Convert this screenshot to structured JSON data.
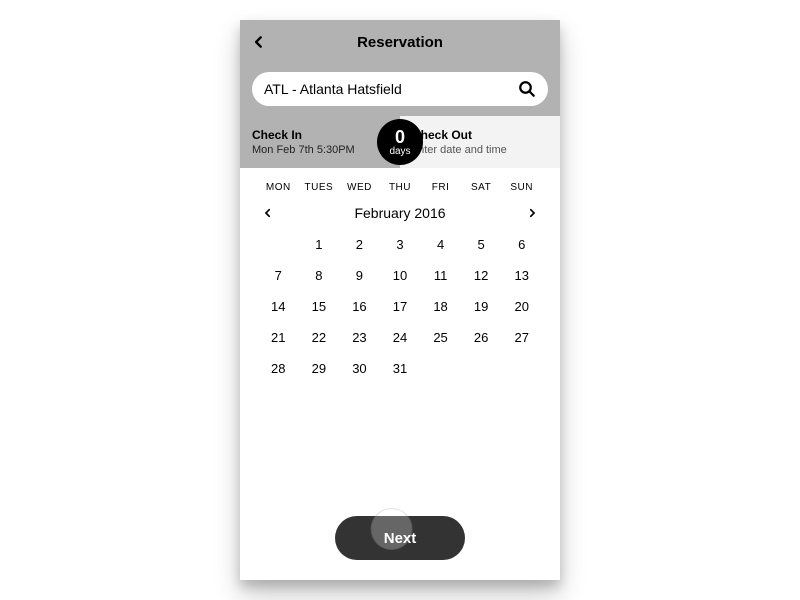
{
  "header": {
    "title": "Reservation"
  },
  "search": {
    "value": "ATL - Atlanta Hatsfield"
  },
  "check_in": {
    "label": "Check In",
    "value": "Mon Feb 7th 5:30PM"
  },
  "check_out": {
    "label": "Check Out",
    "value": "enter date and time"
  },
  "days_badge": {
    "count": "0",
    "unit": "days"
  },
  "calendar": {
    "dow": [
      "MON",
      "TUES",
      "WED",
      "THU",
      "FRI",
      "SAT",
      "SUN"
    ],
    "month_label": "February 2016",
    "leading_blanks": 1,
    "days_in_month": 31
  },
  "next_button": {
    "label": "Next"
  }
}
